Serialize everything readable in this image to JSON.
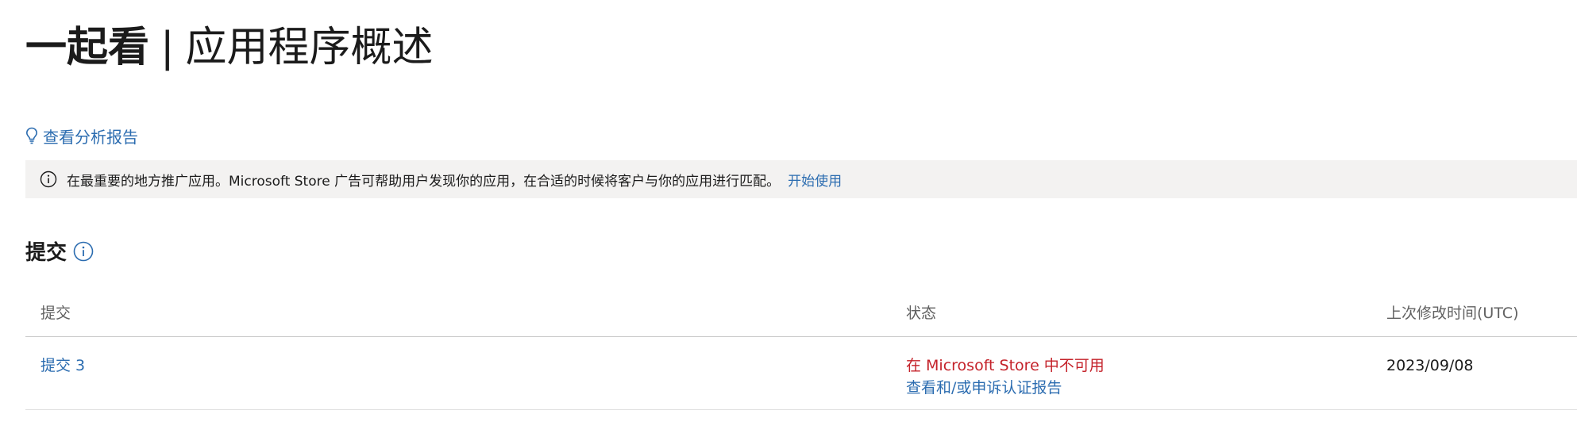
{
  "header": {
    "app_name": "一起看",
    "separator": "|",
    "page_name": "应用程序概述"
  },
  "analytics": {
    "label": "查看分析报告",
    "icon": "lightbulb-icon"
  },
  "banner": {
    "icon": "info-icon",
    "text": "在最重要的地方推广应用。Microsoft Store 广告可帮助用户发现你的应用，在合适的时候将客户与你的应用进行匹配。",
    "cta": "开始使用"
  },
  "submissions": {
    "title": "提交",
    "help_icon": "info-circle-icon",
    "columns": [
      "提交",
      "状态",
      "上次修改时间(UTC)"
    ],
    "rows": [
      {
        "name": "提交 3",
        "status": "在 Microsoft Store 中不可用",
        "status_link": "查看和/或申诉认证报告",
        "modified": "2023/09/08"
      }
    ]
  },
  "colors": {
    "link": "#2b6cb0",
    "error": "#c4222a",
    "banner_bg": "#f3f2f1"
  }
}
